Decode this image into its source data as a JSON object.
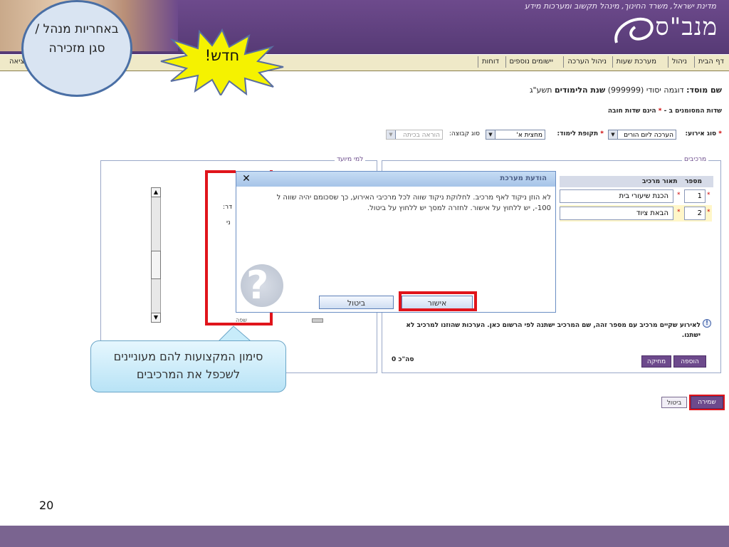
{
  "header": {
    "ministry": "מדינת ישראל, משרד החינוך, מינהל תקשוב ומערכות מידע",
    "app_name": "מנב\"ס",
    "logo_icon": "manbas-swirl-logo"
  },
  "nav": {
    "items": [
      "דף הבית",
      "ניהול",
      "מערכת שעות",
      "ניהול הערכה",
      "יישומים נוספים",
      "דוחות"
    ],
    "left_item": "יציאה"
  },
  "callouts": {
    "top_circle": "באחריות מנהל / סגן מזכירה",
    "new_burst": "חדש!",
    "bottom_bubble": "סימון המקצועות להם מעוניינים לשכפל את המרכיבים"
  },
  "institution": {
    "label": "שם מוסד:",
    "name": "דוגמה יסודי (999999)",
    "year_label": "שנת הלימודים",
    "year": "תשע\"ג"
  },
  "required_note": {
    "prefix": "שדות המסומנים ב - ",
    "star": "*",
    "suffix": " הינם שדות חובה"
  },
  "filters": {
    "event_type_label": "סוג אירוע:",
    "event_type_value": "הערכה ליום הורים",
    "period_label": "תקופת לימוד:",
    "period_value": "מחצית א'",
    "group_label": "סוג קבוצה:",
    "group_value": "הוראה בכיתה"
  },
  "components": {
    "legend": "מרכיבים",
    "col_number": "מספר",
    "col_desc": "תאור מרכיב",
    "rows": [
      {
        "num": "1",
        "desc": "הכנת שיעורי בית"
      },
      {
        "num": "2",
        "desc": "הבאת ציוד"
      }
    ],
    "warning": "לאירוע שקיים מרכיב עם מספר זהה, שם המרכיב ישתנה לפי הרשום כאן. הערכות שהוזנו למרכיב לא ישתנו.",
    "add_button": "הוספה",
    "delete_button": "מחיקה",
    "total": "סה\"כ 0"
  },
  "audience": {
    "legend": "למי מיועד",
    "peek1": "דר:",
    "peek2": "ני",
    "peek3": "שפה"
  },
  "modal": {
    "title": "הודעת מערכת",
    "close_symbol": "✕",
    "message_line1": "לא הוזן ניקוד לאף מרכיב. לחלוקת ניקוד שווה לכל מרכיבי האירוע, כך שסכומם יהיה שווה ל",
    "message_line2": "100-, יש ללחוץ על אישור. לחזרה למסך יש ללחוץ על ביטול.",
    "ok_button": "אישור",
    "cancel_button": "ביטול",
    "question_symbol": "?"
  },
  "bottom_buttons": {
    "save": "שמירה",
    "cancel": "ביטול"
  },
  "page_number": "20",
  "colors": {
    "header_purple": "#6d4a8c",
    "highlight_red": "#e0141b",
    "callout_blue": "#4a6fa5",
    "burst_yellow": "#f5f200",
    "bubble_cyan": "#c8ecfa"
  }
}
